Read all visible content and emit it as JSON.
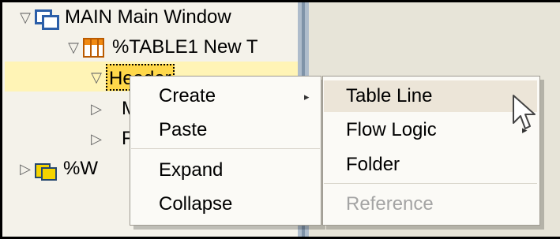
{
  "tree": {
    "items": [
      {
        "label": "MAIN Main Window",
        "icon": "window-icon"
      },
      {
        "label": "%TABLE1 New T",
        "icon": "table-icon"
      },
      {
        "label": "Header"
      },
      {
        "label": "M"
      },
      {
        "label": "F"
      },
      {
        "label": "%W",
        "icon": "folder-icon"
      }
    ]
  },
  "context_menu": {
    "items": [
      {
        "label": "Create",
        "submenu_indicator": "▸"
      },
      {
        "label": "Paste"
      },
      {
        "label": "Expand"
      },
      {
        "label": "Collapse"
      }
    ]
  },
  "submenu": {
    "items": [
      {
        "label": "Table Line"
      },
      {
        "label": "Flow Logic",
        "submenu_indicator": "▸"
      },
      {
        "label": "Folder"
      },
      {
        "label": "Reference",
        "disabled": true
      }
    ]
  },
  "icons": {
    "expanded": "▽",
    "collapsed": "▷"
  },
  "colors": {
    "selection_yellow": "#ffd84a",
    "menu_background": "#fbfaf6",
    "splitter_blue": "#aebccb"
  }
}
